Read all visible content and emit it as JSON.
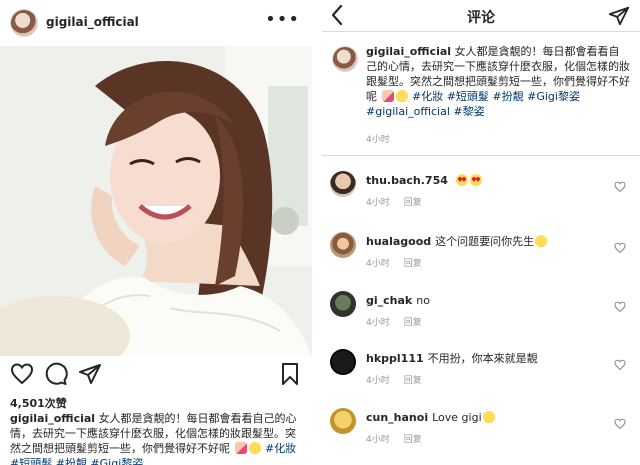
{
  "post": {
    "username": "gigilai_official",
    "more_icon": "more-horizontal-icon",
    "likes": "4,501次赞",
    "caption_user": "gigilai_official",
    "caption_text": "女人都是貪靚的！每日都會看看自己的心情，去研究一下應該穿什麼衣服，化個怎樣的妝跟髮型。突然之間想把頭髮剪短一些，你們覺得好不好呢",
    "caption_tags": "#化妝 #短頭髮 #扮靚 #Gigi黎姿"
  },
  "comments_view": {
    "title": "评论",
    "back_icon": "chevron-left-icon",
    "send_icon": "send-icon",
    "main_comment": {
      "username": "gigilai_official",
      "text": "女人都是貪靚的！每日都會看看自己的心情，去研究一下應該穿什麼衣服，化個怎樣的妝跟髮型。突然之間想把頭髮剪短一些，你們覺得好不好呢",
      "tags": "#化妝 #短頭髮 #扮靚 #Gigi黎姿 #gigilai_official #黎姿",
      "time": "4小时"
    },
    "comments": [
      {
        "username": "thu.bach.754",
        "text": "",
        "emoji": "heart-eyes",
        "time": "4小时",
        "reply": "回复"
      },
      {
        "username": "hualagood",
        "text": "这个问题要问你先生",
        "emoji": "smile",
        "time": "4小时",
        "reply": "回复"
      },
      {
        "username": "gi_chak",
        "text": "no",
        "emoji": "",
        "time": "4小时",
        "reply": "回复"
      },
      {
        "username": "hkppl111",
        "text": "不用扮，你本來就是靚",
        "emoji": "",
        "time": "4小时",
        "reply": "回复"
      },
      {
        "username": "cun_hanoi",
        "text": "Love gigi",
        "emoji": "smile",
        "time": "4小时",
        "reply": "回复"
      }
    ]
  },
  "colors": {
    "link": "#00376b",
    "meta": "#999999",
    "divider": "#dbdbdb"
  }
}
